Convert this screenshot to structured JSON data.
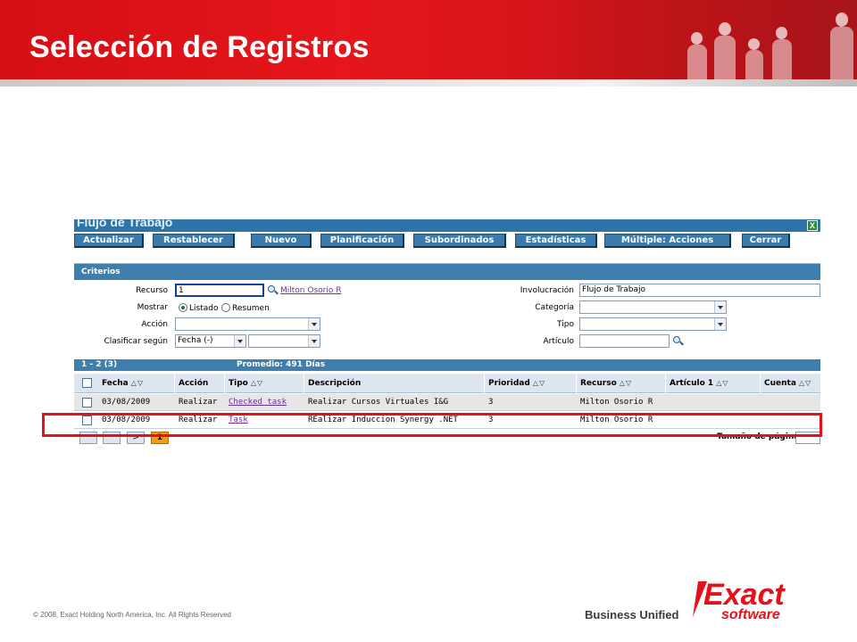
{
  "slide": {
    "title": "Selección de Registros",
    "copyright": "© 2008, Exact Holding North America, Inc. All Rights Reserved",
    "tagline": "Business Unified",
    "logo_top": "Exact",
    "logo_bottom": "software"
  },
  "colors": {
    "brand_red": "#e4101a",
    "app_blue": "#3f7fae",
    "link_purple": "#6a2f9b"
  },
  "app": {
    "title": "Flujo de Trabajo",
    "toolbar": {
      "actualizar": "Actualizar",
      "restablecer": "Restablecer",
      "nuevo": "Nuevo",
      "planificacion": "Planificación",
      "subordinados": "Subordinados",
      "estadisticas": "Estadísticas",
      "multiple": "Múltiple: Acciones",
      "cerrar": "Cerrar"
    },
    "criteria": {
      "header": "Criterios",
      "recurso_label": "Recurso",
      "recurso_value": "1",
      "recurso_name": "Milton Osorio R",
      "mostrar_label": "Mostrar",
      "listado": "Listado",
      "resumen": "Resumen",
      "accion_label": "Acción",
      "clasificar_label": "Clasificar según",
      "clasificar_value": "Fecha (-)",
      "involucracion_label": "Involucración",
      "involucracion_value": "Flujo de Trabajo",
      "categoria_label": "Categoría",
      "tipo_label": "Tipo",
      "articulo_label": "Artículo"
    },
    "results": {
      "count": "1 - 2 (3)",
      "average": "Promedio: 491 Días"
    },
    "columns": {
      "fecha": "Fecha",
      "accion": "Acción",
      "tipo": "Tipo",
      "descripcion": "Descripción",
      "prioridad": "Prioridad",
      "recurso": "Recurso",
      "articulo": "Artículo 1",
      "cuenta": "Cuenta"
    },
    "rows": [
      {
        "fecha": "03/08/2009",
        "accion": "Realizar",
        "tipo": "Checked task",
        "descripcion": "Realizar Cursos Virtuales I&G",
        "prioridad": "3",
        "recurso": "Milton Osorio R"
      },
      {
        "fecha": "03/08/2009",
        "accion": "Realizar",
        "tipo": "Task",
        "descripcion": "REalizar Induccion Synergy .NET",
        "prioridad": "3",
        "recurso": "Milton Osorio R"
      }
    ],
    "pager": {
      "next": ">",
      "current_page": "1",
      "page_size_label": "Tamaño de página"
    }
  }
}
